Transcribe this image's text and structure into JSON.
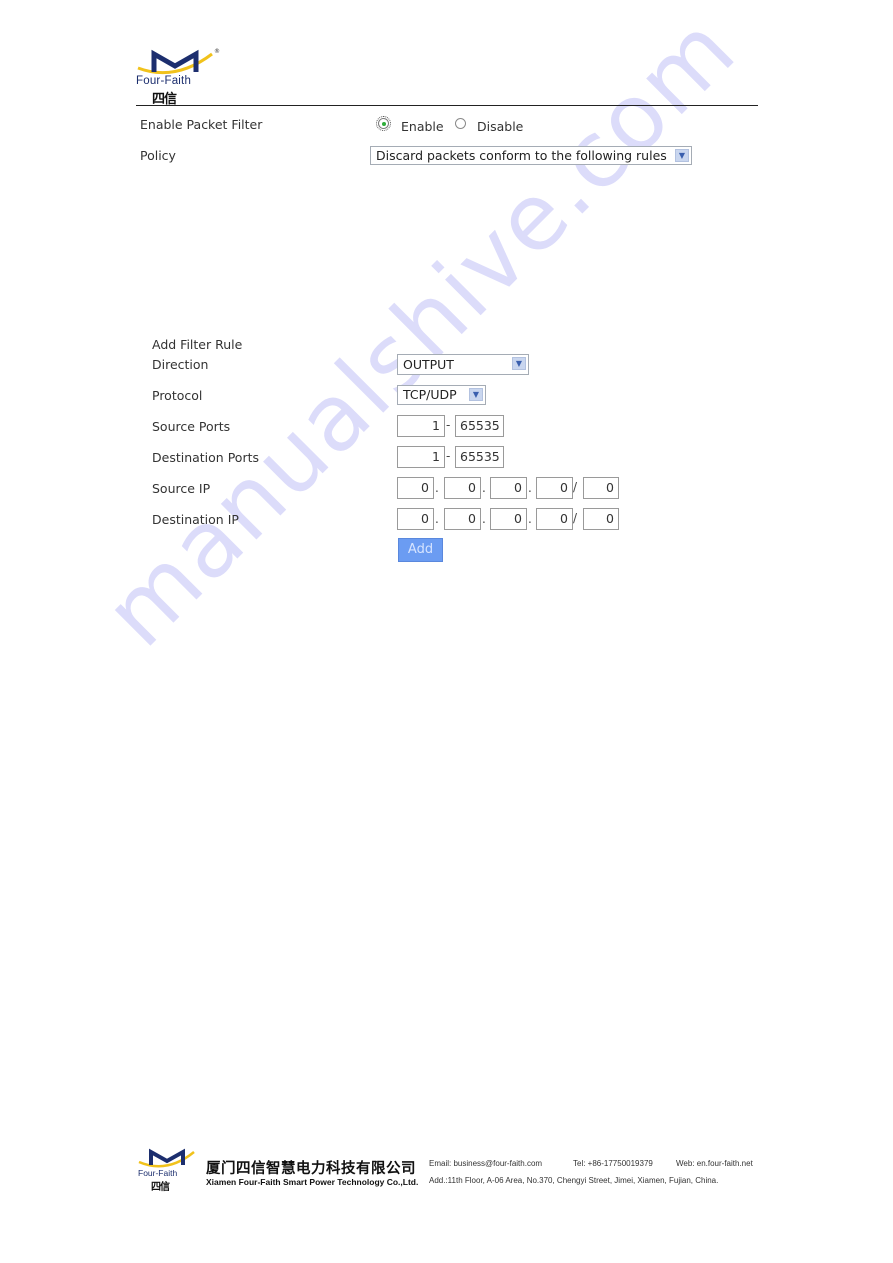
{
  "header": {
    "logo_brand": "Four-Faith",
    "logo_cn": "四信",
    "logo_reg": "®"
  },
  "filter": {
    "enable_label": "Enable Packet Filter",
    "radio_options": [
      {
        "label": "Enable",
        "checked": true
      },
      {
        "label": "Disable",
        "checked": false
      }
    ],
    "policy_label": "Policy",
    "policy_value": "Discard packets conform to the following rules"
  },
  "rule": {
    "title": "Add Filter Rule",
    "direction_label": "Direction",
    "direction_value": "OUTPUT",
    "protocol_label": "Protocol",
    "protocol_value": "TCP/UDP",
    "source_ports_label": "Source Ports",
    "source_ports": {
      "from": "1",
      "to": "65535"
    },
    "dest_ports_label": "Destination Ports",
    "dest_ports": {
      "from": "1",
      "to": "65535"
    },
    "source_ip_label": "Source IP",
    "source_ip": [
      "0",
      "0",
      "0",
      "0",
      "0"
    ],
    "dest_ip_label": "Destination IP",
    "dest_ip": [
      "0",
      "0",
      "0",
      "0",
      "0"
    ],
    "range_sep": "-",
    "dot_sep": ".",
    "mask_sep": "/",
    "add_label": "Add"
  },
  "watermark": "manualshive.com",
  "footer": {
    "logo_brand": "Four-Faith",
    "logo_cn": "四信",
    "company_cn": "厦门四信智慧电力科技有限公司",
    "company_en": "Xiamen Four-Faith Smart Power Technology Co.,Ltd.",
    "email": "Email: business@four-faith.com",
    "tel": "Tel: +86-17750019379",
    "web": "Web: en.four-faith.net",
    "address": "Add.:11th Floor, A-06 Area, No.370, Chengyi Street, Jimei, Xiamen, Fujian, China."
  }
}
